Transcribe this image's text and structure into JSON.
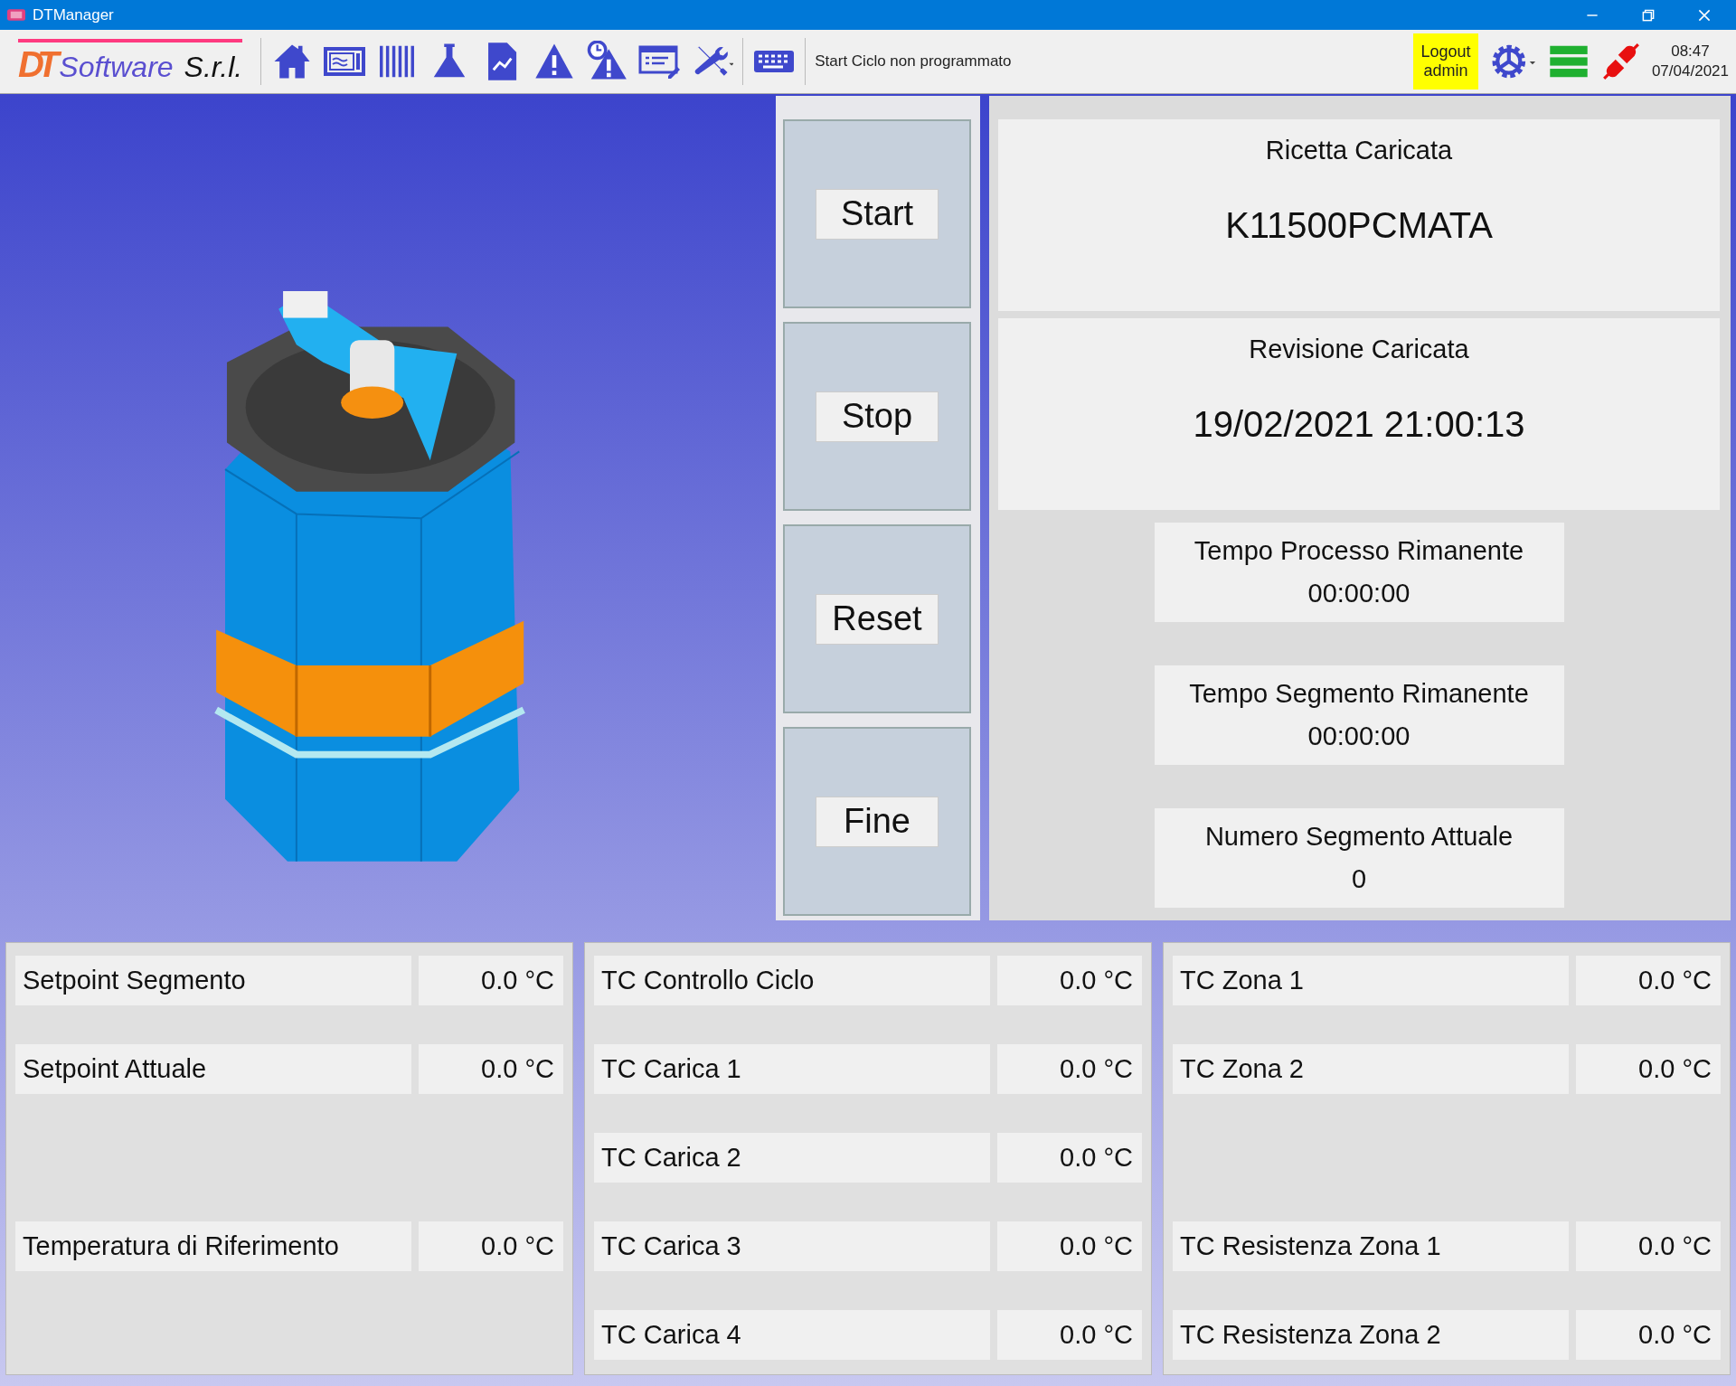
{
  "window": {
    "title": "DTManager"
  },
  "toolbar": {
    "logo_mark": "DT",
    "logo_name": "Software",
    "logo_suffix": "S.r.l.",
    "status_message": "Start Ciclo non programmato",
    "logout": "Logout",
    "user": "admin",
    "time": "08:47",
    "date": "07/04/2021"
  },
  "commands": [
    {
      "label": "Start"
    },
    {
      "label": "Stop"
    },
    {
      "label": "Reset"
    },
    {
      "label": "Fine"
    }
  ],
  "recipe": {
    "title": "Ricetta Caricata",
    "value": "K11500PCMATA"
  },
  "revision": {
    "title": "Revisione Caricata",
    "value": "19/02/2021 21:00:13"
  },
  "timers": [
    {
      "label": "Tempo Processo Rimanente",
      "value": "00:00:00"
    },
    {
      "label": "Tempo Segmento Rimanente",
      "value": "00:00:00"
    },
    {
      "label": "Numero Segmento Attuale",
      "value": "0"
    }
  ],
  "panels": [
    {
      "rows": [
        {
          "kind": "reading",
          "label": "Setpoint Segmento",
          "value": "0.0 °C"
        },
        {
          "kind": "reading",
          "label": "Setpoint Attuale",
          "value": "0.0 °C"
        },
        {
          "kind": "blank"
        },
        {
          "kind": "reading",
          "label": "Temperatura di Riferimento",
          "value": "0.0 °C"
        }
      ]
    },
    {
      "rows": [
        {
          "kind": "reading",
          "label": "TC Controllo Ciclo",
          "value": "0.0 °C"
        },
        {
          "kind": "reading",
          "label": "TC Carica 1",
          "value": "0.0 °C"
        },
        {
          "kind": "reading",
          "label": "TC Carica 2",
          "value": "0.0 °C"
        },
        {
          "kind": "reading",
          "label": "TC Carica 3",
          "value": "0.0 °C"
        },
        {
          "kind": "reading",
          "label": "TC Carica 4",
          "value": "0.0 °C"
        }
      ]
    },
    {
      "rows": [
        {
          "kind": "reading",
          "label": "TC Zona 1",
          "value": "0.0 °C"
        },
        {
          "kind": "reading",
          "label": "TC Zona 2",
          "value": "0.0 °C"
        },
        {
          "kind": "blank"
        },
        {
          "kind": "reading",
          "label": "TC Resistenza Zona 1",
          "value": "0.0 °C"
        },
        {
          "kind": "reading",
          "label": "TC Resistenza Zona 2",
          "value": "0.0 °C"
        }
      ]
    }
  ]
}
